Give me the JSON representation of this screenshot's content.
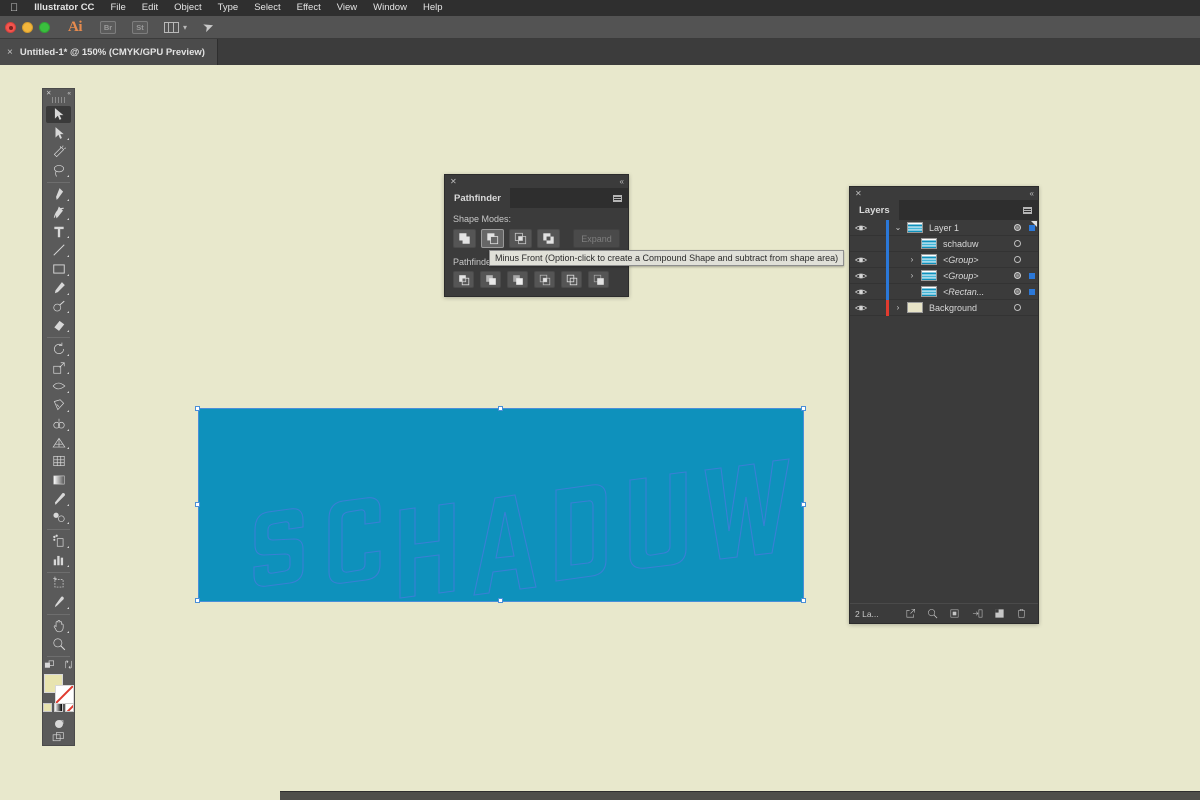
{
  "menubar": {
    "apple_icon": "apple-icon",
    "app_name": "Illustrator CC",
    "items": [
      "File",
      "Edit",
      "Object",
      "Type",
      "Select",
      "Effect",
      "View",
      "Window",
      "Help"
    ]
  },
  "appbar": {
    "logo": "Ai",
    "bridge_label": "Br",
    "stock_label": "St",
    "icons": [
      "bridge-icon",
      "stock-icon",
      "arrange-documents-icon",
      "chevron-down-icon",
      "share-icon"
    ]
  },
  "document_tab": {
    "close_glyph": "×",
    "title": "Untitled-1* @ 150% (CMYK/GPU Preview)"
  },
  "toolbar": {
    "tools": [
      {
        "name": "selection-tool",
        "selected": true
      },
      {
        "name": "direct-selection-tool",
        "selected": false
      },
      {
        "name": "magic-wand-tool",
        "selected": false
      },
      {
        "name": "lasso-tool",
        "selected": false
      },
      {
        "name": "pen-tool",
        "selected": false
      },
      {
        "name": "curvature-tool",
        "selected": false
      },
      {
        "name": "type-tool",
        "selected": false
      },
      {
        "name": "line-segment-tool",
        "selected": false
      },
      {
        "name": "rectangle-tool",
        "selected": false
      },
      {
        "name": "paintbrush-tool",
        "selected": false
      },
      {
        "name": "shaper-tool",
        "selected": false
      },
      {
        "name": "eraser-tool",
        "selected": false
      },
      {
        "name": "rotate-tool",
        "selected": false
      },
      {
        "name": "scale-tool",
        "selected": false
      },
      {
        "name": "width-tool",
        "selected": false
      },
      {
        "name": "free-transform-tool",
        "selected": false
      },
      {
        "name": "shape-builder-tool",
        "selected": false
      },
      {
        "name": "perspective-grid-tool",
        "selected": false
      },
      {
        "name": "mesh-tool",
        "selected": false
      },
      {
        "name": "gradient-tool",
        "selected": false
      },
      {
        "name": "eyedropper-tool",
        "selected": false
      },
      {
        "name": "blend-tool",
        "selected": false
      },
      {
        "name": "symbol-sprayer-tool",
        "selected": false
      },
      {
        "name": "column-graph-tool",
        "selected": false
      },
      {
        "name": "artboard-tool",
        "selected": false
      },
      {
        "name": "slice-tool",
        "selected": false
      },
      {
        "name": "hand-tool",
        "selected": false
      },
      {
        "name": "zoom-tool",
        "selected": false
      }
    ],
    "fill_color": "#E8E4AF",
    "stroke_color": "none",
    "swatch_icons": [
      "color-swatch",
      "gradient-swatch",
      "none-swatch"
    ],
    "bottom_icons": [
      "drawing-mode-icon",
      "screen-mode-icon"
    ]
  },
  "pathfinder_panel": {
    "title": "Pathfinder",
    "shape_modes_label": "Shape Modes:",
    "pathfinders_label": "Pathfinders:",
    "expand_label": "Expand",
    "expand_enabled": false,
    "shape_modes": [
      {
        "name": "unite-button",
        "hover": false
      },
      {
        "name": "minus-front-button",
        "hover": true
      },
      {
        "name": "intersect-button",
        "hover": false
      },
      {
        "name": "exclude-button",
        "hover": false
      }
    ],
    "pathfinders": [
      {
        "name": "divide-button"
      },
      {
        "name": "trim-button"
      },
      {
        "name": "merge-button"
      },
      {
        "name": "crop-button"
      },
      {
        "name": "outline-button"
      },
      {
        "name": "minus-back-button"
      }
    ]
  },
  "tooltip": {
    "text": "Minus Front (Option-click to create a Compound Shape and subtract from shape area)"
  },
  "layers_panel": {
    "title": "Layers",
    "rows": [
      {
        "name": "Layer 1",
        "indent": 0,
        "visible": true,
        "expanded": true,
        "has_chevron": true,
        "color": "#2B78D8",
        "thumb": "art",
        "target_on": true,
        "selected": true,
        "italic": false,
        "corner": true
      },
      {
        "name": "schaduw",
        "indent": 1,
        "visible": false,
        "expanded": false,
        "has_chevron": false,
        "color": "#2B78D8",
        "thumb": "art",
        "target_on": false,
        "selected": false,
        "italic": false,
        "corner": false
      },
      {
        "name": "<Group>",
        "indent": 1,
        "visible": true,
        "expanded": false,
        "has_chevron": true,
        "color": "#2B78D8",
        "thumb": "art",
        "target_on": false,
        "selected": false,
        "italic": true,
        "corner": false
      },
      {
        "name": "<Group>",
        "indent": 1,
        "visible": true,
        "expanded": false,
        "has_chevron": true,
        "color": "#2B78D8",
        "thumb": "art",
        "target_on": true,
        "selected": true,
        "italic": true,
        "corner": false
      },
      {
        "name": "<Rectan...",
        "indent": 1,
        "visible": true,
        "expanded": false,
        "has_chevron": false,
        "color": "#2B78D8",
        "thumb": "art",
        "target_on": true,
        "selected": true,
        "italic": true,
        "corner": false
      },
      {
        "name": "Background",
        "indent": 0,
        "visible": true,
        "expanded": false,
        "has_chevron": true,
        "color": "#E03B2F",
        "thumb": "bg",
        "target_on": false,
        "selected": false,
        "italic": false,
        "corner": false
      }
    ],
    "footer": {
      "count_label": "2 La...",
      "buttons": [
        "locate-object-icon",
        "make-clipping-mask-icon",
        "create-new-sublayer-icon",
        "create-new-layer-icon",
        "delete-selection-icon"
      ]
    }
  },
  "artwork": {
    "text": "SCHADUW",
    "fill_color": "#0E91BC",
    "outline_color": "#3A7FD5",
    "selection_color": "#4A8FD8",
    "canvas_color": "#E8E8CC",
    "zoom": "150%"
  }
}
